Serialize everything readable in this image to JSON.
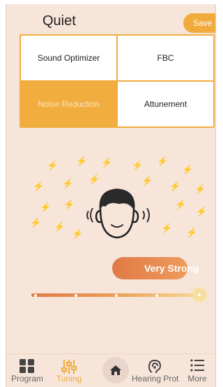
{
  "header": {
    "title": "Quiet",
    "save_label": "Save"
  },
  "options": [
    {
      "label": "Sound Optimizer",
      "active": false
    },
    {
      "label": "FBC",
      "active": false
    },
    {
      "label": "Noise Reduction",
      "active": true
    },
    {
      "label": "Attunement",
      "active": false
    }
  ],
  "noise_reduction": {
    "level_label": "Very Strong",
    "level_index": 4,
    "level_count": 5
  },
  "tabbar": {
    "program": "Program",
    "tuning": "Tuning",
    "hearing_protection": "Hearing Prot",
    "more": "More",
    "active": "tuning"
  },
  "colors": {
    "accent": "#f0ab3c",
    "background": "#f7e5da",
    "slider_start": "#e07a45",
    "slider_end": "#f5d994"
  }
}
